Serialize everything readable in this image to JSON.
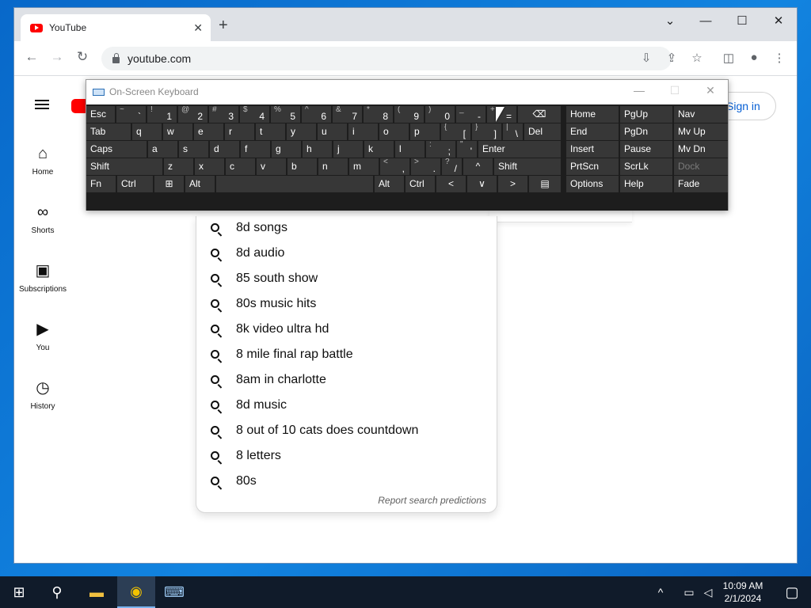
{
  "browser": {
    "tab_title": "YouTube",
    "tab_close": "✕",
    "new_tab": "+",
    "url": "youtube.com",
    "window_controls": {
      "tabs_menu": "⌄",
      "minimize": "—",
      "maximize": "☐",
      "close": "✕"
    },
    "nav": {
      "back": "←",
      "forward": "→",
      "reload": "↻"
    },
    "toolbar_icons": {
      "install": "⇩",
      "share": "⇪",
      "bookmark": "☆",
      "side_panel": "◫",
      "profile": "●",
      "menu": "⋮"
    }
  },
  "youtube": {
    "sidebar": [
      {
        "label": "Home",
        "icon": "⌂"
      },
      {
        "label": "Shorts",
        "icon": "∞"
      },
      {
        "label": "Subscriptions",
        "icon": "▣"
      },
      {
        "label": "You",
        "icon": "▶"
      },
      {
        "label": "History",
        "icon": "◷"
      }
    ],
    "signin": "Sign in",
    "suggestions": [
      "8d songs",
      "8d audio",
      "85 south show",
      "80s music hits",
      "8k video ultra hd",
      "8 mile final rap battle",
      "8am in charlotte",
      "8d music",
      "8 out of 10 cats does countdown",
      "8 letters",
      "80s"
    ],
    "report": "Report search predictions"
  },
  "osk": {
    "title": "On-Screen Keyboard",
    "controls": {
      "minimize": "—",
      "maximize": "☐",
      "close": "✕"
    },
    "rows": [
      [
        {
          "m": "Esc"
        },
        {
          "s": "~",
          "p": "`"
        },
        {
          "s": "!",
          "p": "1"
        },
        {
          "s": "@",
          "p": "2"
        },
        {
          "s": "#",
          "p": "3"
        },
        {
          "s": "$",
          "p": "4"
        },
        {
          "s": "%",
          "p": "5"
        },
        {
          "s": "^",
          "p": "6"
        },
        {
          "s": "&",
          "p": "7"
        },
        {
          "s": "*",
          "p": "8"
        },
        {
          "s": "(",
          "p": "9"
        },
        {
          "s": ")",
          "p": "0"
        },
        {
          "s": "_",
          "p": "-"
        },
        {
          "s": "+",
          "p": "="
        },
        {
          "m": "⌫"
        },
        {
          "m": "Home"
        },
        {
          "m": "PgUp"
        },
        {
          "m": "Nav"
        }
      ],
      [
        {
          "m": "Tab"
        },
        {
          "m": "q"
        },
        {
          "m": "w"
        },
        {
          "m": "e"
        },
        {
          "m": "r"
        },
        {
          "m": "t"
        },
        {
          "m": "y"
        },
        {
          "m": "u"
        },
        {
          "m": "i"
        },
        {
          "m": "o"
        },
        {
          "m": "p"
        },
        {
          "s": "{",
          "p": "["
        },
        {
          "s": "}",
          "p": "]"
        },
        {
          "s": "|",
          "p": "\\"
        },
        {
          "m": "Del"
        },
        {
          "m": "End"
        },
        {
          "m": "PgDn"
        },
        {
          "m": "Mv Up"
        }
      ],
      [
        {
          "m": "Caps"
        },
        {
          "m": "a"
        },
        {
          "m": "s"
        },
        {
          "m": "d"
        },
        {
          "m": "f"
        },
        {
          "m": "g"
        },
        {
          "m": "h"
        },
        {
          "m": "j"
        },
        {
          "m": "k"
        },
        {
          "m": "l"
        },
        {
          "s": ":",
          "p": ";"
        },
        {
          "s": "\"",
          "p": "'"
        },
        {
          "m": "Enter"
        },
        {
          "m": "Insert"
        },
        {
          "m": "Pause"
        },
        {
          "m": "Mv Dn"
        }
      ],
      [
        {
          "m": "Shift"
        },
        {
          "m": "z"
        },
        {
          "m": "x"
        },
        {
          "m": "c"
        },
        {
          "m": "v"
        },
        {
          "m": "b"
        },
        {
          "m": "n"
        },
        {
          "m": "m"
        },
        {
          "s": "<",
          "p": ","
        },
        {
          "s": ">",
          "p": "."
        },
        {
          "s": "?",
          "p": "/"
        },
        {
          "m": "^"
        },
        {
          "m": "Shift"
        },
        {
          "m": "PrtScn"
        },
        {
          "m": "ScrLk"
        },
        {
          "m": "Dock",
          "dim": true
        }
      ],
      [
        {
          "m": "Fn"
        },
        {
          "m": "Ctrl"
        },
        {
          "m": "⊞"
        },
        {
          "m": "Alt"
        },
        {
          "m": ""
        },
        {
          "m": "Alt"
        },
        {
          "m": "Ctrl"
        },
        {
          "m": "<"
        },
        {
          "m": "∨"
        },
        {
          "m": ">"
        },
        {
          "m": "▤"
        },
        {
          "m": "Options"
        },
        {
          "m": "Help"
        },
        {
          "m": "Fade"
        }
      ]
    ]
  },
  "taskbar": {
    "icons": {
      "start": "⊞",
      "search": "⚲",
      "explorer": "▬",
      "chrome": "◉",
      "osk": "⌨"
    },
    "tray": {
      "chevron": "^",
      "network": "▭",
      "volume": "◁",
      "notifications": "▢"
    },
    "time": "10:09 AM",
    "date": "2/1/2024"
  }
}
